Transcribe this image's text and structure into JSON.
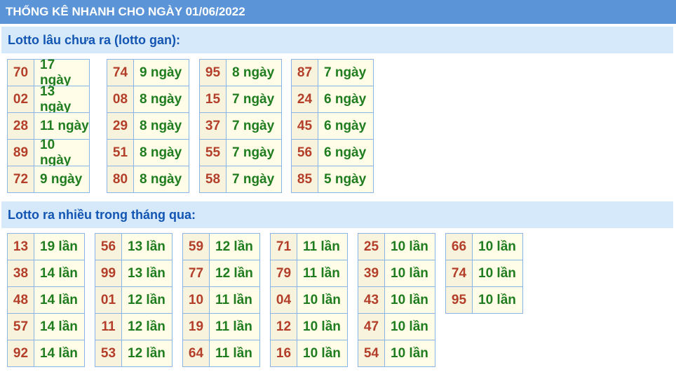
{
  "header": {
    "title": "THỐNG KÊ NHANH CHO NGÀY 01/06/2022"
  },
  "gan": {
    "title": "Lotto lâu chưa ra (lotto gan):",
    "groups": [
      [
        {
          "n": "70",
          "v": "17 ngày"
        },
        {
          "n": "02",
          "v": "13 ngày"
        },
        {
          "n": "28",
          "v": "11 ngày"
        },
        {
          "n": "89",
          "v": "10 ngày"
        },
        {
          "n": "72",
          "v": "9 ngày"
        }
      ],
      [
        {
          "n": "74",
          "v": "9 ngày"
        },
        {
          "n": "08",
          "v": "8 ngày"
        },
        {
          "n": "29",
          "v": "8 ngày"
        },
        {
          "n": "51",
          "v": "8 ngày"
        },
        {
          "n": "80",
          "v": "8 ngày"
        }
      ],
      [
        {
          "n": "95",
          "v": "8 ngày"
        },
        {
          "n": "15",
          "v": "7 ngày"
        },
        {
          "n": "37",
          "v": "7 ngày"
        },
        {
          "n": "55",
          "v": "7 ngày"
        },
        {
          "n": "58",
          "v": "7 ngày"
        }
      ],
      [
        {
          "n": "87",
          "v": "7 ngày"
        },
        {
          "n": "24",
          "v": "6 ngày"
        },
        {
          "n": "45",
          "v": "6 ngày"
        },
        {
          "n": "56",
          "v": "6 ngày"
        },
        {
          "n": "85",
          "v": "5 ngày"
        }
      ]
    ]
  },
  "nhieu": {
    "title": "Lotto ra nhiều trong tháng qua:",
    "groups": [
      [
        {
          "n": "13",
          "v": "19 lần"
        },
        {
          "n": "38",
          "v": "14 lần"
        },
        {
          "n": "48",
          "v": "14 lần"
        },
        {
          "n": "57",
          "v": "14 lần"
        },
        {
          "n": "92",
          "v": "14 lần"
        }
      ],
      [
        {
          "n": "56",
          "v": "13 lần"
        },
        {
          "n": "99",
          "v": "13 lần"
        },
        {
          "n": "01",
          "v": "12 lần"
        },
        {
          "n": "11",
          "v": "12 lần"
        },
        {
          "n": "53",
          "v": "12 lần"
        }
      ],
      [
        {
          "n": "59",
          "v": "12 lần"
        },
        {
          "n": "77",
          "v": "12 lần"
        },
        {
          "n": "10",
          "v": "11 lần"
        },
        {
          "n": "19",
          "v": "11 lần"
        },
        {
          "n": "64",
          "v": "11 lần"
        }
      ],
      [
        {
          "n": "71",
          "v": "11 lần"
        },
        {
          "n": "79",
          "v": "11 lần"
        },
        {
          "n": "04",
          "v": "10 lần"
        },
        {
          "n": "12",
          "v": "10 lần"
        },
        {
          "n": "16",
          "v": "10 lần"
        }
      ],
      [
        {
          "n": "25",
          "v": "10 lần"
        },
        {
          "n": "39",
          "v": "10 lần"
        },
        {
          "n": "43",
          "v": "10 lần"
        },
        {
          "n": "47",
          "v": "10 lần"
        },
        {
          "n": "54",
          "v": "10 lần"
        }
      ],
      [
        {
          "n": "66",
          "v": "10 lần"
        },
        {
          "n": "74",
          "v": "10 lần"
        },
        {
          "n": "95",
          "v": "10 lần"
        }
      ]
    ]
  },
  "colors": {
    "header_bg": "#5b95d8",
    "section_bg": "#d6e9fb",
    "number": "#b33e2a",
    "value": "#1f7d1f",
    "border": "#8ab3e6"
  }
}
